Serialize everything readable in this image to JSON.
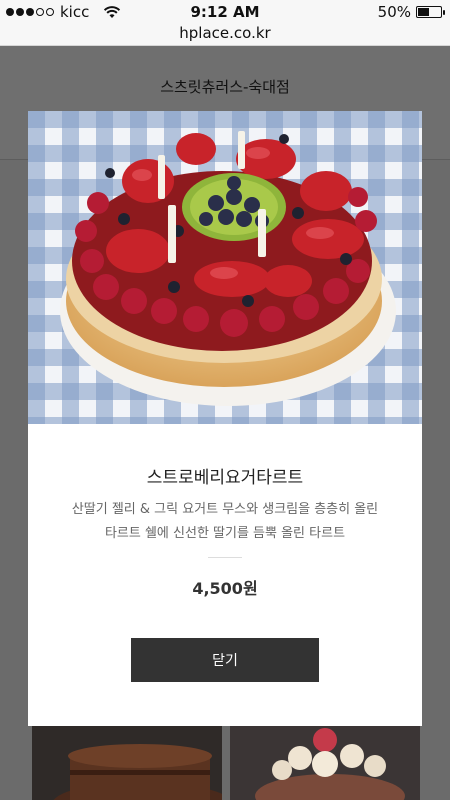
{
  "status_bar": {
    "carrier": "kicc",
    "time": "9:12 AM",
    "battery": "50%",
    "battery_level": 0.5
  },
  "address_bar": {
    "url": "hplace.co.kr"
  },
  "page": {
    "store_name": "스츠릿츄러스-숙대점"
  },
  "modal": {
    "product_name": "스트로베리요거타르트",
    "description_line1": "산딸기 젤리 & 그릭 요거트 무스와 생크림을 층층히 올린",
    "description_line2": "타르트 쉘에 신선한 딸기를 듬뿍 올린 타르트",
    "price": "4,500원",
    "close_label": "닫기"
  },
  "icons": [
    "signal-dots-icon",
    "wifi-icon",
    "battery-icon"
  ],
  "colors": {
    "overlay": "#6b6b6b",
    "button": "#333333",
    "text_muted": "#666666"
  }
}
